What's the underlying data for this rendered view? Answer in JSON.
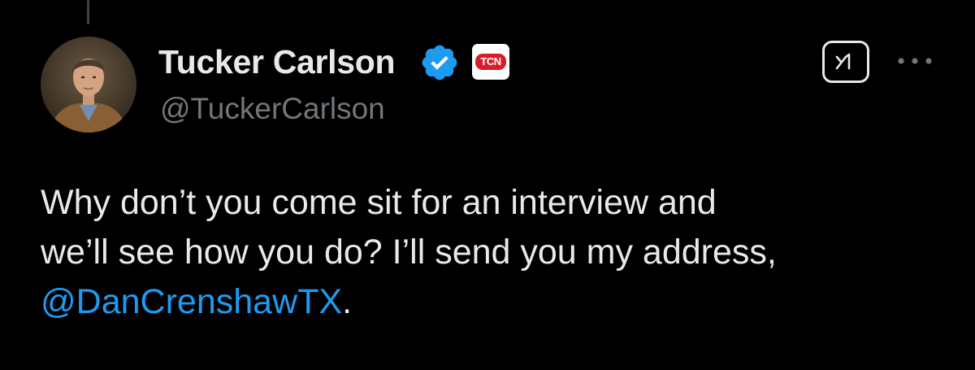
{
  "tweet": {
    "author": {
      "display_name": "Tucker Carlson",
      "handle": "@TuckerCarlson",
      "verified": true,
      "affiliate_badge_text": "TCN"
    },
    "text_lines": [
      "Why don’t you come sit for an interview and",
      "we’ll see how you do? I’ll send you my address,"
    ],
    "mention": "@DanCrenshawTX",
    "trailing_text": "."
  },
  "icons": {
    "verified": "verified-checkmark-icon",
    "grok": "grok-icon",
    "more": "more-dots-icon"
  },
  "colors": {
    "background": "#000000",
    "text": "#e7e9ea",
    "secondary_text": "#71767b",
    "link": "#1d9bf0",
    "verified": "#1d9bf0",
    "affiliate_red": "#d71e28"
  }
}
